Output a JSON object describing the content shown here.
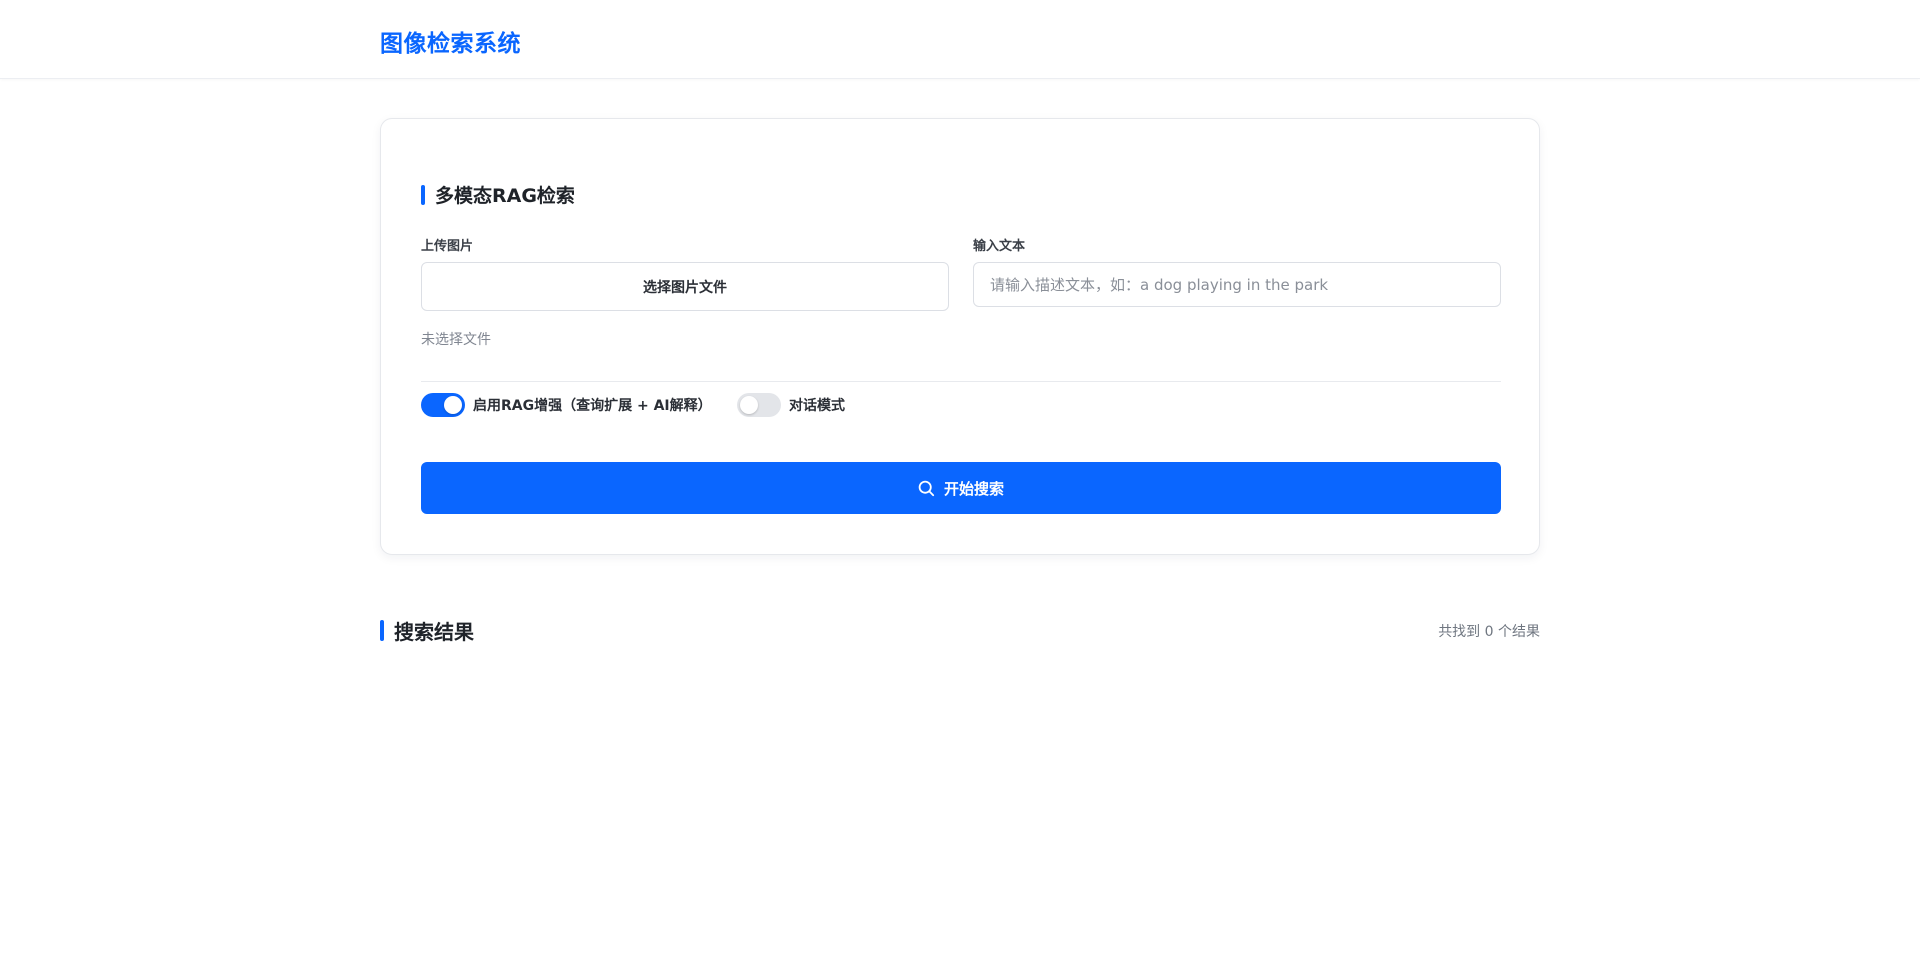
{
  "header": {
    "app_title": "图像检索系统"
  },
  "search_card": {
    "title": "多模态RAG检索",
    "upload": {
      "label": "上传图片",
      "button_label": "选择图片文件",
      "status": "未选择文件"
    },
    "text_query": {
      "label": "输入文本",
      "value": "",
      "placeholder": "请输入描述文本，如：a dog playing in the park"
    },
    "toggles": [
      {
        "label": "启用RAG增强（查询扩展 + AI解释）",
        "enabled": true
      },
      {
        "label": "对话模式",
        "enabled": false
      }
    ],
    "search_button": {
      "label": "开始搜索",
      "icon": "search-icon"
    }
  },
  "results": {
    "title": "搜索结果",
    "count_text": "共找到 0 个结果",
    "items": []
  },
  "colors": {
    "accent": "#0a66ff",
    "toggle_off": "#e3e5e9"
  }
}
